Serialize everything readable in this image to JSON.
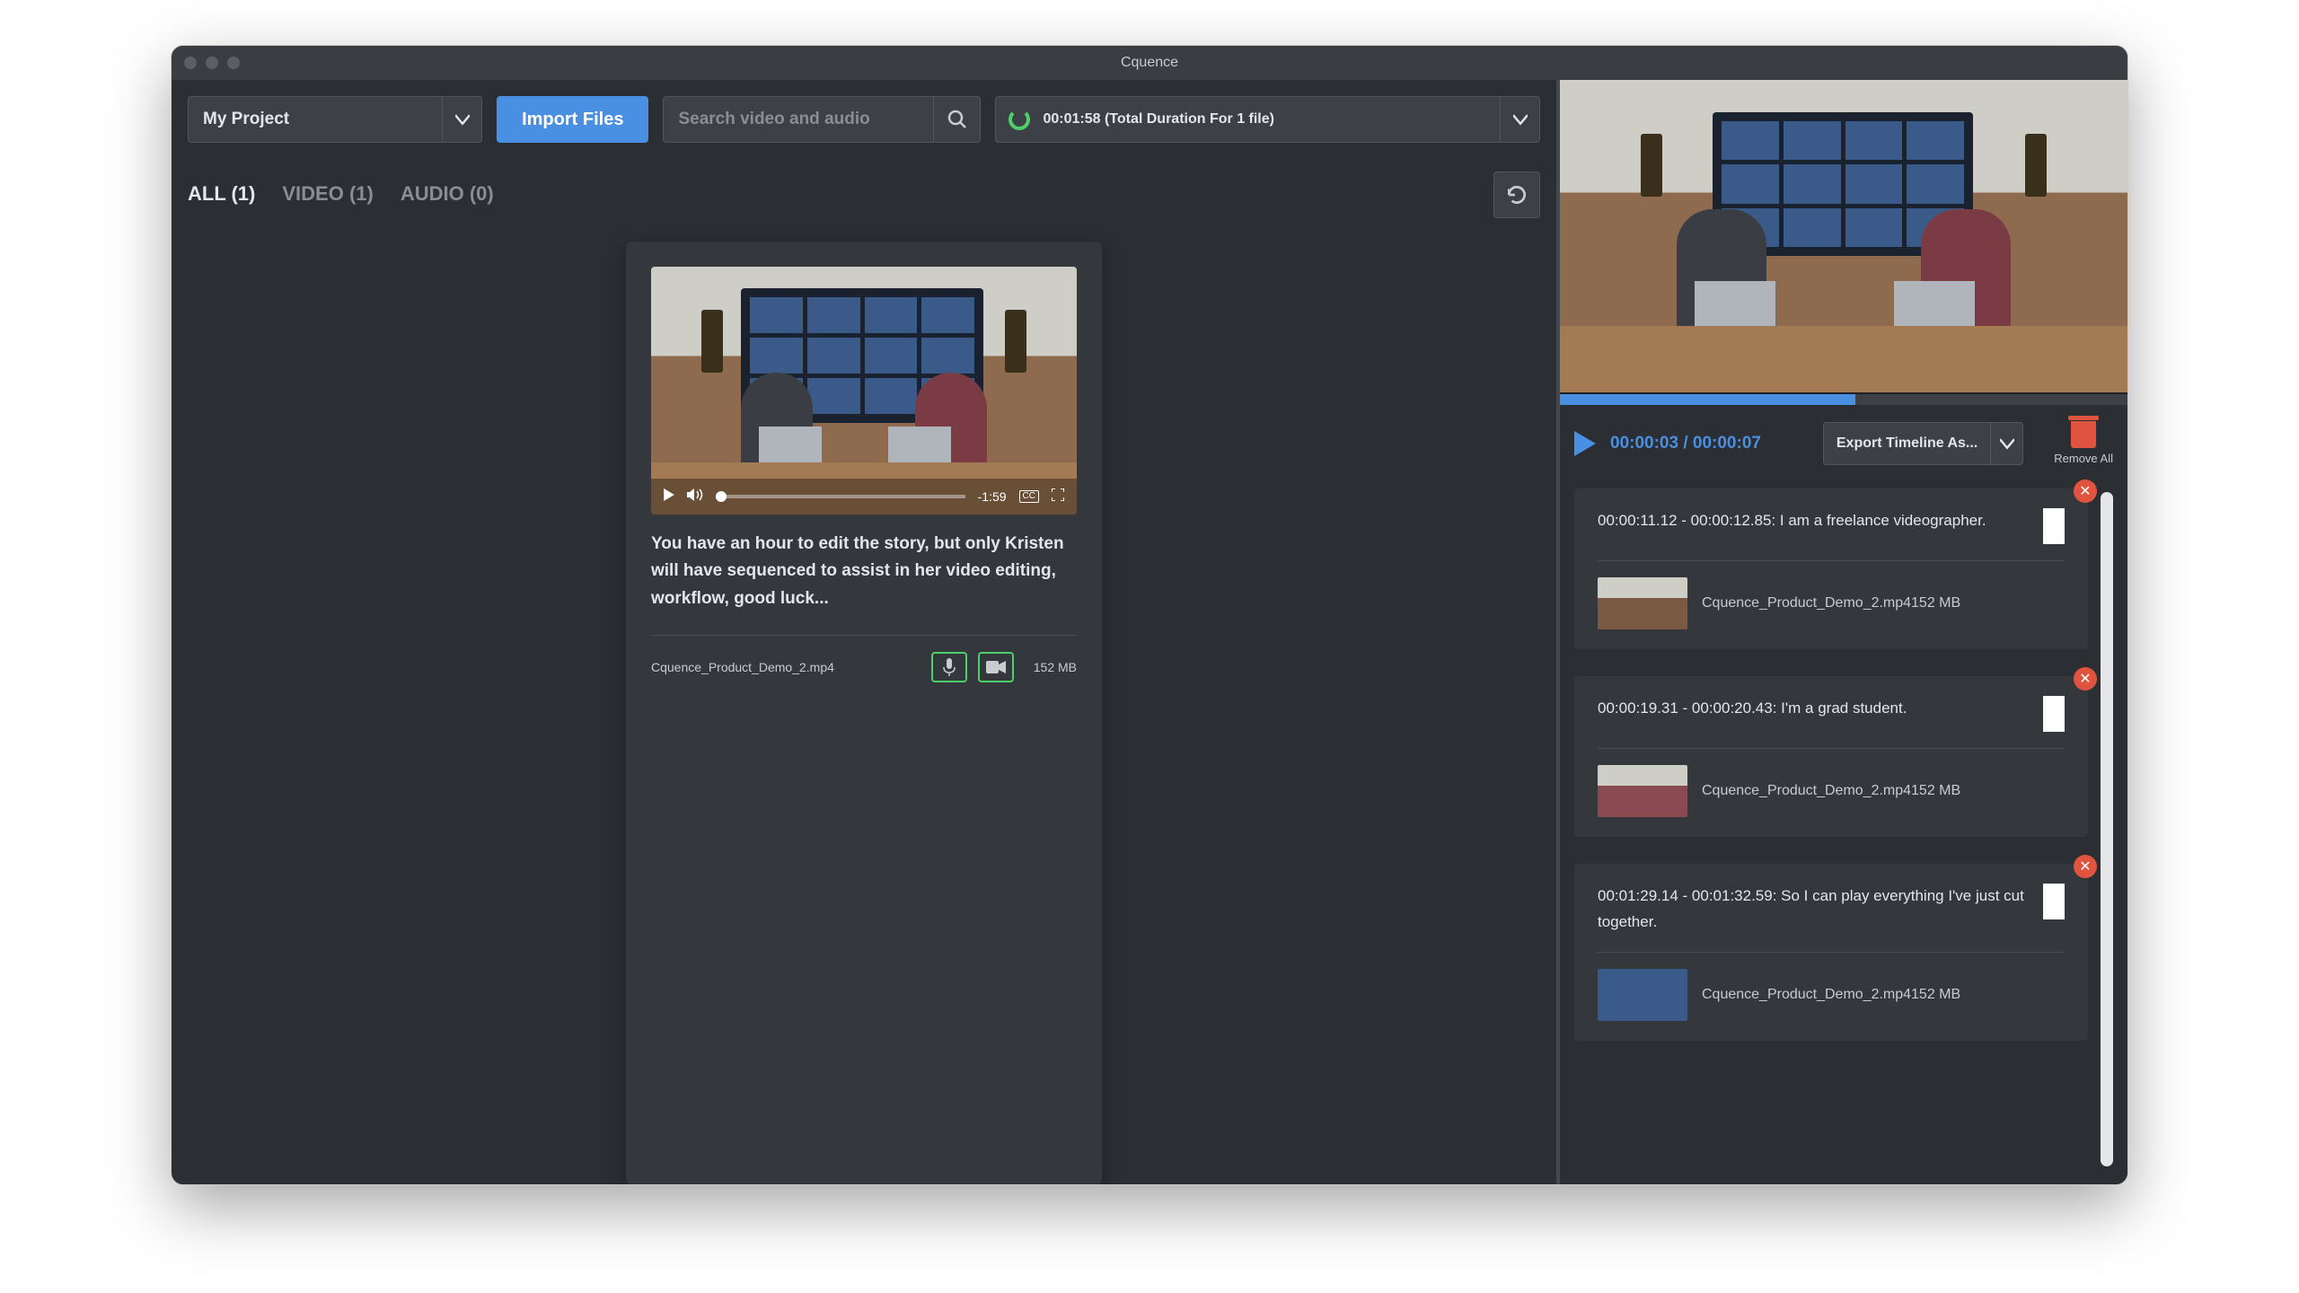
{
  "window": {
    "title": "Cquence"
  },
  "toolbar": {
    "project_name": "My Project",
    "import_label": "Import Files",
    "search_placeholder": "Search video and audio",
    "duration_text": "00:01:58 (Total Duration For 1 file)"
  },
  "tabs": {
    "all": "ALL (1)",
    "video": "VIDEO (1)",
    "audio": "AUDIO (0)"
  },
  "card": {
    "time_remaining": "-1:59",
    "cc": "CC",
    "description": "You have an hour to edit the story, but only Kristen will have sequenced to assist in her video editing, workflow, good luck...",
    "filename": "Cquence_Product_Demo_2.mp4",
    "filesize": "152 MB"
  },
  "preview": {
    "current": "00:00:03",
    "sep": " / ",
    "total": "00:00:07",
    "export_label": "Export Timeline As...",
    "remove_all": "Remove All"
  },
  "clips": [
    {
      "text": "00:00:11.12 - 00:00:12.85: I am a freelance videographer.",
      "meta": "Cquence_Product_Demo_2.mp4152 MB"
    },
    {
      "text": "00:00:19.31 - 00:00:20.43: I'm a grad student.",
      "meta": "Cquence_Product_Demo_2.mp4152 MB"
    },
    {
      "text": "00:01:29.14 - 00:01:32.59: So I can play everything I've just cut together.",
      "meta": "Cquence_Product_Demo_2.mp4152 MB"
    }
  ]
}
